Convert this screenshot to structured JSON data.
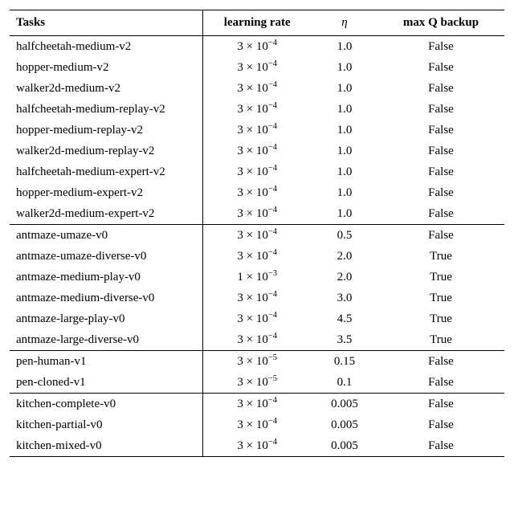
{
  "headers": {
    "tasks": "Tasks",
    "lr": "learning rate",
    "eta": "η",
    "maxq": "max Q backup"
  },
  "chart_data": {
    "type": "table",
    "columns": [
      "Tasks",
      "learning rate",
      "eta",
      "max Q backup"
    ],
    "groups": [
      {
        "rows": [
          {
            "task": "halfcheetah-medium-v2",
            "lr_base": 3,
            "lr_exp": -4,
            "eta": "1.0",
            "maxq": "False"
          },
          {
            "task": "hopper-medium-v2",
            "lr_base": 3,
            "lr_exp": -4,
            "eta": "1.0",
            "maxq": "False"
          },
          {
            "task": "walker2d-medium-v2",
            "lr_base": 3,
            "lr_exp": -4,
            "eta": "1.0",
            "maxq": "False"
          },
          {
            "task": "halfcheetah-medium-replay-v2",
            "lr_base": 3,
            "lr_exp": -4,
            "eta": "1.0",
            "maxq": "False"
          },
          {
            "task": "hopper-medium-replay-v2",
            "lr_base": 3,
            "lr_exp": -4,
            "eta": "1.0",
            "maxq": "False"
          },
          {
            "task": "walker2d-medium-replay-v2",
            "lr_base": 3,
            "lr_exp": -4,
            "eta": "1.0",
            "maxq": "False"
          },
          {
            "task": "halfcheetah-medium-expert-v2",
            "lr_base": 3,
            "lr_exp": -4,
            "eta": "1.0",
            "maxq": "False"
          },
          {
            "task": "hopper-medium-expert-v2",
            "lr_base": 3,
            "lr_exp": -4,
            "eta": "1.0",
            "maxq": "False"
          },
          {
            "task": "walker2d-medium-expert-v2",
            "lr_base": 3,
            "lr_exp": -4,
            "eta": "1.0",
            "maxq": "False"
          }
        ]
      },
      {
        "rows": [
          {
            "task": "antmaze-umaze-v0",
            "lr_base": 3,
            "lr_exp": -4,
            "eta": "0.5",
            "maxq": "False"
          },
          {
            "task": "antmaze-umaze-diverse-v0",
            "lr_base": 3,
            "lr_exp": -4,
            "eta": "2.0",
            "maxq": "True"
          },
          {
            "task": "antmaze-medium-play-v0",
            "lr_base": 1,
            "lr_exp": -3,
            "eta": "2.0",
            "maxq": "True"
          },
          {
            "task": "antmaze-medium-diverse-v0",
            "lr_base": 3,
            "lr_exp": -4,
            "eta": "3.0",
            "maxq": "True"
          },
          {
            "task": "antmaze-large-play-v0",
            "lr_base": 3,
            "lr_exp": -4,
            "eta": "4.5",
            "maxq": "True"
          },
          {
            "task": "antmaze-large-diverse-v0",
            "lr_base": 3,
            "lr_exp": -4,
            "eta": "3.5",
            "maxq": "True"
          }
        ]
      },
      {
        "rows": [
          {
            "task": "pen-human-v1",
            "lr_base": 3,
            "lr_exp": -5,
            "eta": "0.15",
            "maxq": "False"
          },
          {
            "task": "pen-cloned-v1",
            "lr_base": 3,
            "lr_exp": -5,
            "eta": "0.1",
            "maxq": "False"
          }
        ]
      },
      {
        "rows": [
          {
            "task": "kitchen-complete-v0",
            "lr_base": 3,
            "lr_exp": -4,
            "eta": "0.005",
            "maxq": "False"
          },
          {
            "task": "kitchen-partial-v0",
            "lr_base": 3,
            "lr_exp": -4,
            "eta": "0.005",
            "maxq": "False"
          },
          {
            "task": "kitchen-mixed-v0",
            "lr_base": 3,
            "lr_exp": -4,
            "eta": "0.005",
            "maxq": "False"
          }
        ]
      }
    ]
  }
}
